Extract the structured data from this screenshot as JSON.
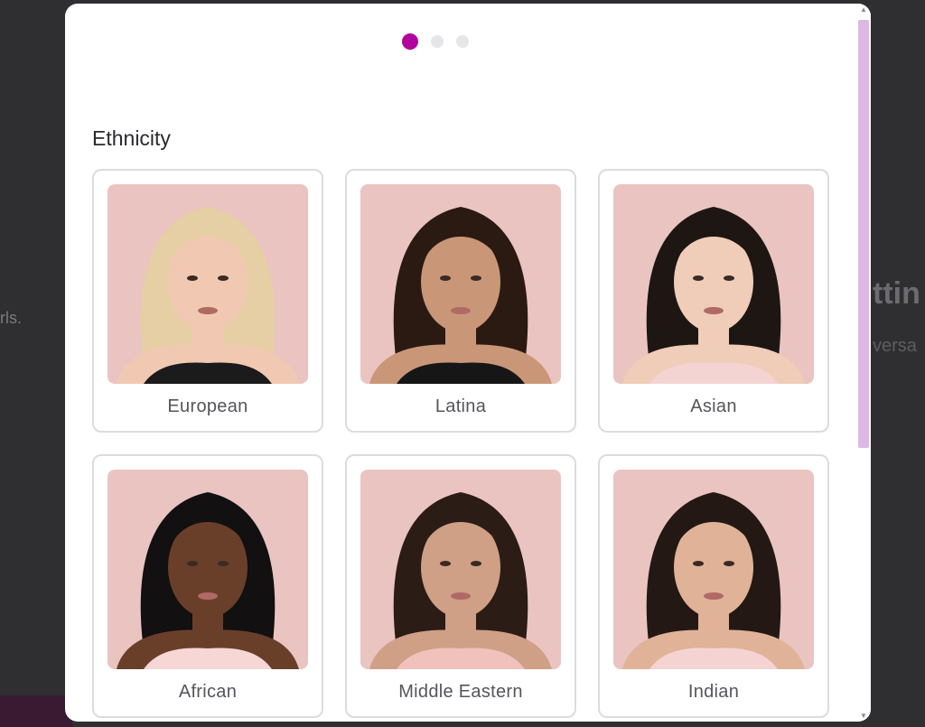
{
  "background": {
    "left_fragment": "rls.",
    "title_fragment": "ttin",
    "subtitle_fragment": "versa"
  },
  "progress": {
    "steps": 3,
    "current": 1
  },
  "section": {
    "title": "Ethnicity"
  },
  "options": [
    {
      "label": "European",
      "hair": "#e6cfa4",
      "skin": "#f1c9b2",
      "top": "#1b1b1b"
    },
    {
      "label": "Latina",
      "hair": "#2a1a12",
      "skin": "#c99778",
      "top": "#161616"
    },
    {
      "label": "Asian",
      "hair": "#1e1613",
      "skin": "#efcdb9",
      "top": "#f4d3d3"
    },
    {
      "label": "African",
      "hair": "#121010",
      "skin": "#6a3f2a",
      "top": "#f7d6d6"
    },
    {
      "label": "Middle Eastern",
      "hair": "#2b1c15",
      "skin": "#cf9f86",
      "top": "#f0c2bb"
    },
    {
      "label": "Indian",
      "hair": "#231814",
      "skin": "#e0b298",
      "top": "#f6d3d3"
    }
  ],
  "colors": {
    "accent": "#b0049c",
    "photo_bg": "#eac4c0",
    "scroll_thumb": "#dcb8e2"
  }
}
